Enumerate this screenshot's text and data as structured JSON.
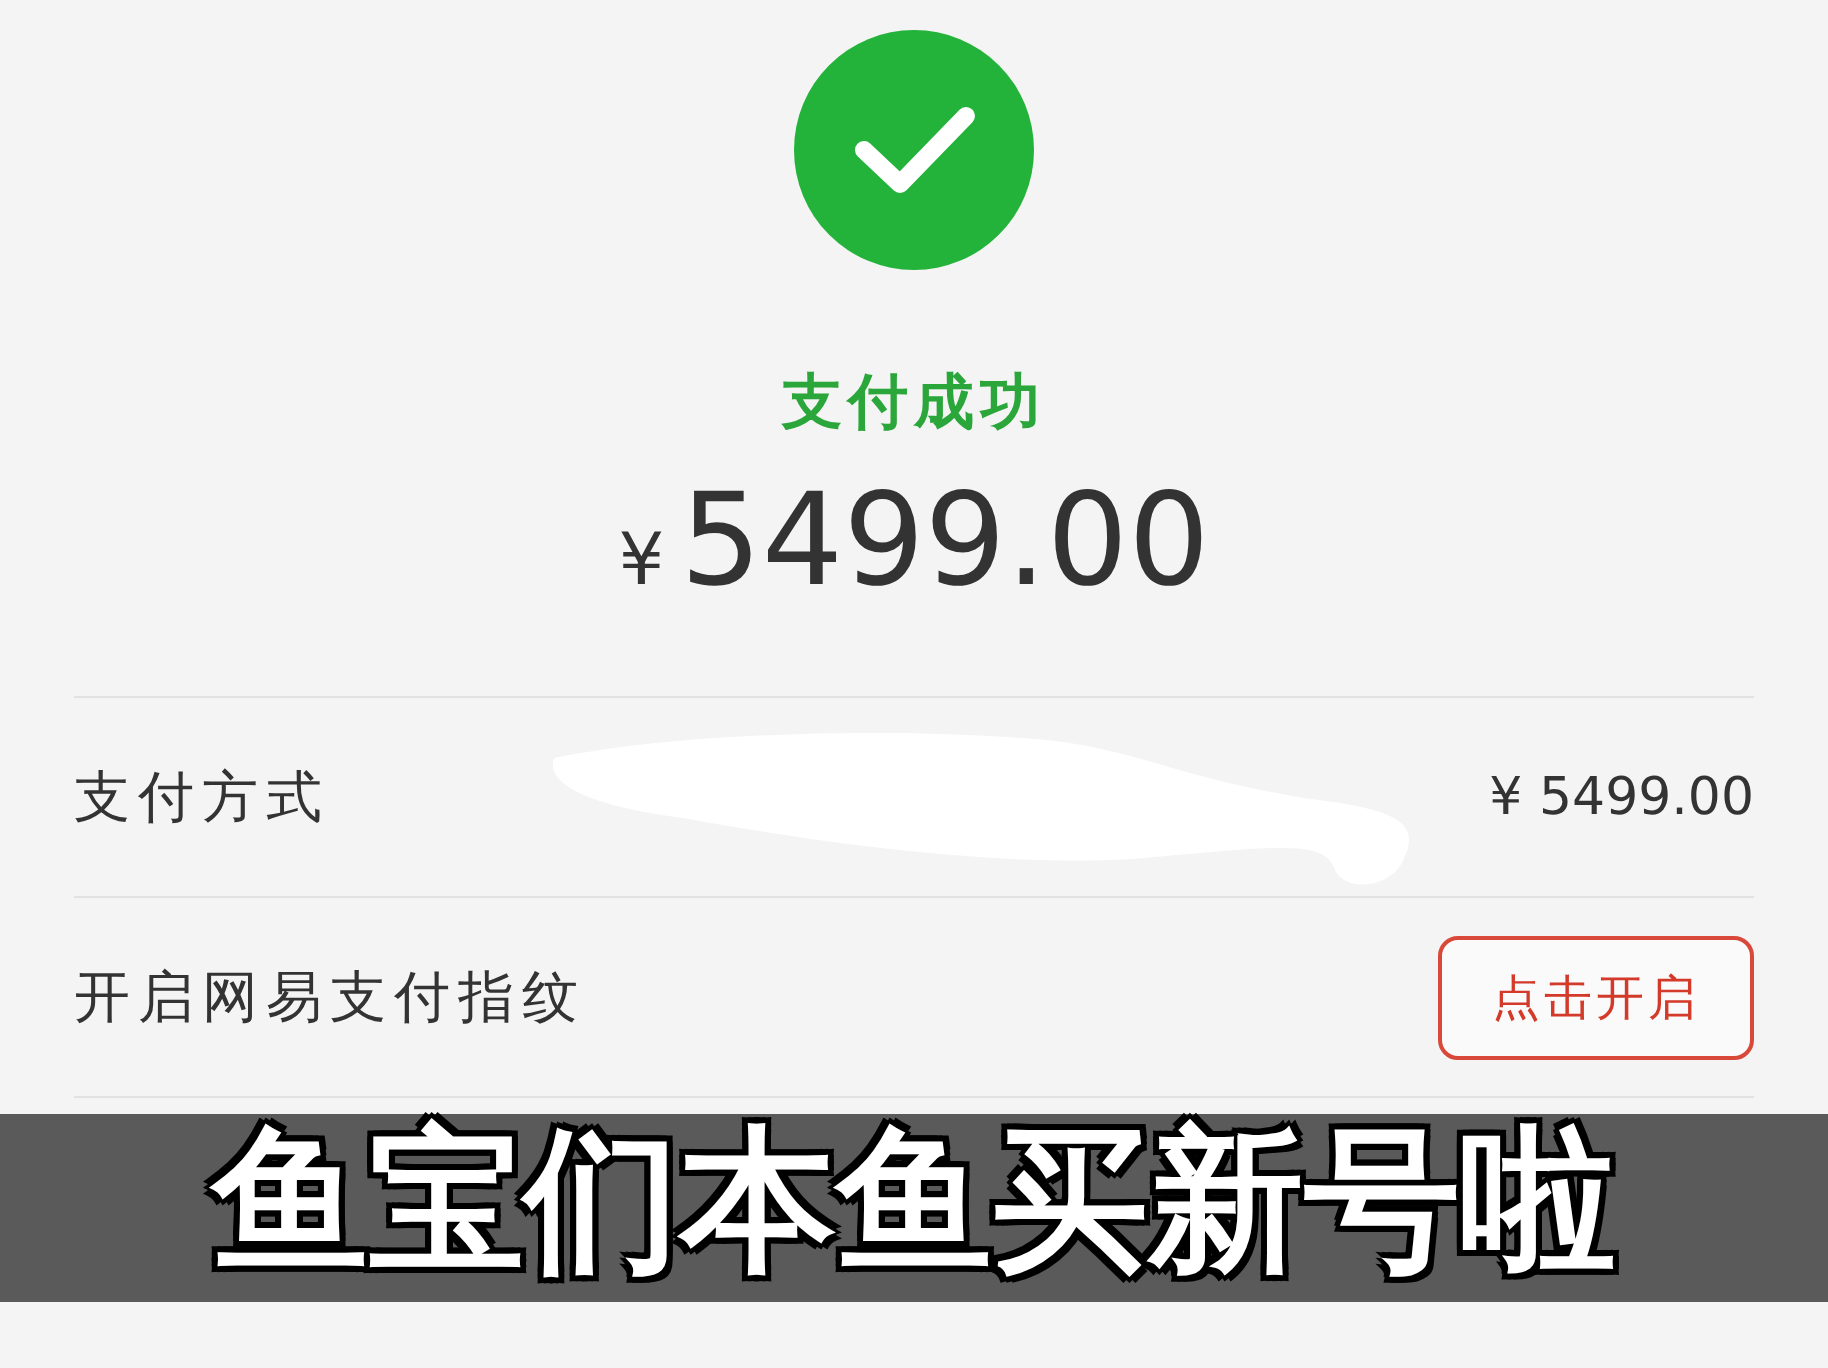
{
  "status": {
    "title": "支付成功",
    "currency": "¥",
    "amount": "5499.00"
  },
  "rows": [
    {
      "kind": "value",
      "label": "支付方式",
      "value": "¥ 5499.00",
      "redacted": true
    },
    {
      "kind": "button",
      "label": "开启网易支付指纹",
      "button": "点击开启"
    }
  ],
  "caption": "鱼宝们本鱼买新号啦"
}
